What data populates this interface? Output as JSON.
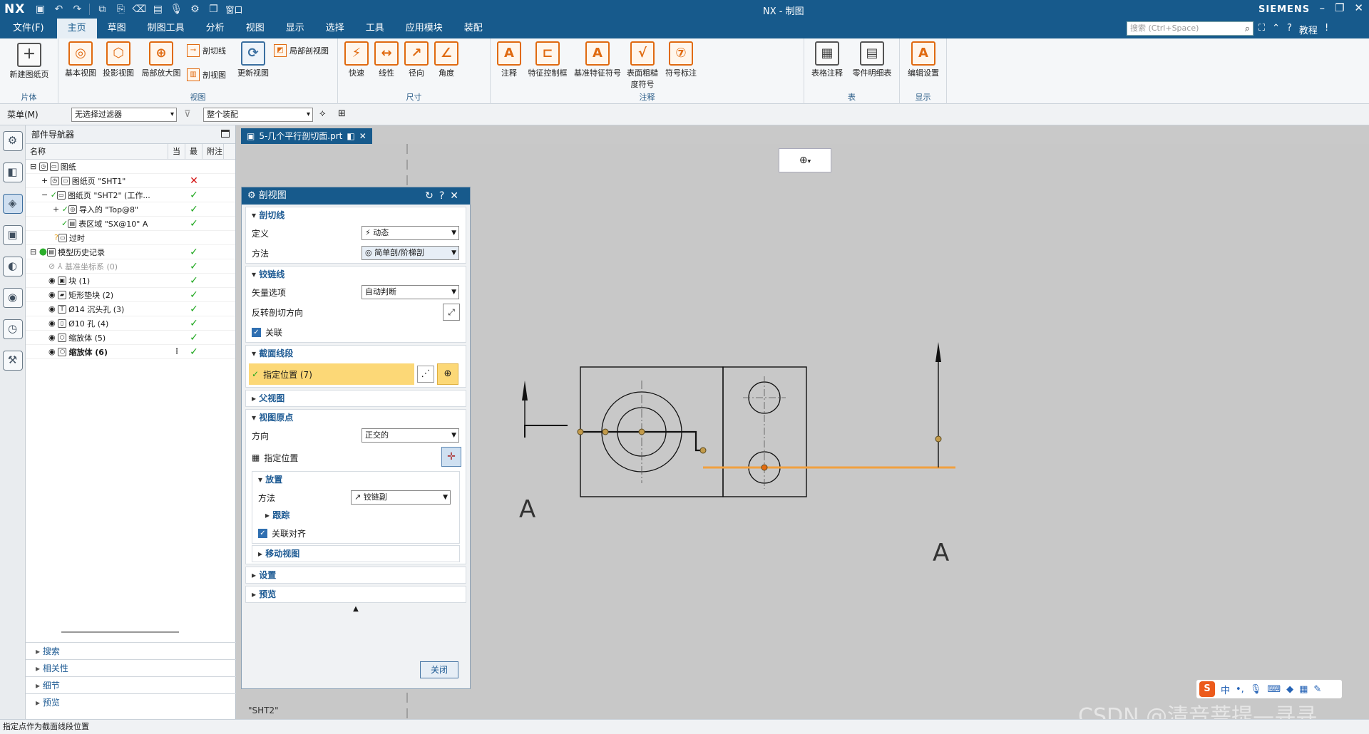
{
  "titlebar": {
    "logo": "NX",
    "window_menu": "窗口",
    "title": "NX - 制图",
    "brand": "SIEMENS"
  },
  "menubar": {
    "file": "文件(F)",
    "tabs": [
      "主页",
      "草图",
      "制图工具",
      "分析",
      "视图",
      "显示",
      "选择",
      "工具",
      "应用模块",
      "装配"
    ],
    "active_tab": "主页",
    "search_placeholder": "搜索 (Ctrl+Space)",
    "tutorial": "教程"
  },
  "ribbon": {
    "groups": {
      "sheet": {
        "label": "片体",
        "new_sheet": "新建图纸页"
      },
      "view": {
        "label": "视图",
        "base": "基本视图",
        "projected": "投影视图",
        "detail": "局部放大图",
        "section_line": "剖切线",
        "section_view": "剖视图",
        "update": "更新视图",
        "break_view": "局部剖视图"
      },
      "dimension": {
        "label": "尺寸",
        "rapid": "快速",
        "linear": "线性",
        "radial": "径向",
        "angular": "角度"
      },
      "annotation": {
        "label": "注释",
        "note": "注释",
        "fcf": "特征控制框",
        "datum": "基准特征符号",
        "surface": "表面粗糙度符号",
        "symbol": "符号标注"
      },
      "table": {
        "label": "表",
        "tabular": "表格注释",
        "parts_list": "零件明细表"
      },
      "display": {
        "label": "显示",
        "edit_settings": "编辑设置"
      }
    }
  },
  "toolbar2": {
    "menu": "菜单(M)",
    "filter": "无选择过滤器",
    "assembly": "整个装配"
  },
  "navigator": {
    "title": "部件导航器",
    "headers": {
      "name": "名称",
      "c1": "当",
      "c2": "最",
      "c3": "附注"
    },
    "rows": [
      {
        "name": "图纸",
        "status": ""
      },
      {
        "name": "图纸页 \"SHT1\"",
        "status": "cross"
      },
      {
        "name": "图纸页 \"SHT2\" (工作...",
        "status": "check"
      },
      {
        "name": "导入的 \"Top@8\"",
        "status": "check"
      },
      {
        "name": "表区域 \"SX@10\" A",
        "status": "check"
      },
      {
        "name": "过时",
        "status": ""
      },
      {
        "name": "模型历史记录",
        "status": "check"
      },
      {
        "name": "基准坐标系 (0)",
        "status": "check"
      },
      {
        "name": "块 (1)",
        "status": "check"
      },
      {
        "name": "矩形垫块 (2)",
        "status": "check"
      },
      {
        "name": "Ø14 沉头孔 (3)",
        "status": "check"
      },
      {
        "name": "Ø10 孔 (4)",
        "status": "check"
      },
      {
        "name": "缩放体 (5)",
        "status": "check"
      },
      {
        "name": "缩放体 (6)",
        "status": "check"
      }
    ],
    "bottom_sections": [
      "搜索",
      "相关性",
      "细节",
      "预览"
    ]
  },
  "document": {
    "tab": "5-几个平行剖切面.prt",
    "sheet_label": "\"SHT2\""
  },
  "dialog": {
    "title": "剖视图",
    "section_line": {
      "header": "剖切线",
      "definition_label": "定义",
      "definition_value": "动态",
      "method_label": "方法",
      "method_value": "简单剖/阶梯剖"
    },
    "hinge_line": {
      "header": "铰链线",
      "vector_label": "矢量选项",
      "vector_value": "自动判断",
      "reverse_label": "反转剖切方向",
      "associative": "关联"
    },
    "segment": {
      "header": "截面线段",
      "specify": "指定位置 (7)"
    },
    "parent": {
      "header": "父视图"
    },
    "origin": {
      "header": "视图原点",
      "direction_label": "方向",
      "direction_value": "正交的",
      "specify": "指定位置",
      "placement": {
        "header": "放置",
        "method_label": "方法",
        "method_value": "铰链副",
        "track": "跟踪",
        "align": "关联对齐"
      },
      "move": "移动视图"
    },
    "settings": "设置",
    "preview": "预览",
    "close": "关闭"
  },
  "drawing": {
    "section_letter": "A"
  },
  "status": {
    "message": "指定点作为截面线段位置"
  },
  "ime": {
    "logo": "S",
    "lang": "中"
  },
  "watermark": "CSDN @清音菩提—寻寻",
  "colors": {
    "nx_blue": "#175a8c",
    "highlight_yellow": "#fcd877",
    "section_orange": "#f0a040"
  }
}
